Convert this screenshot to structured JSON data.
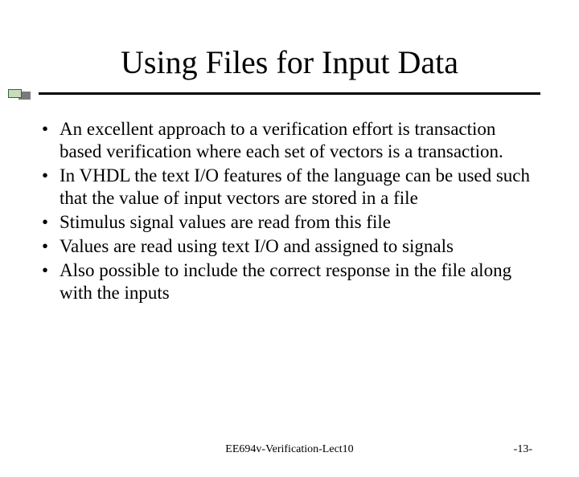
{
  "slide": {
    "title": "Using Files for Input Data",
    "bullets": [
      "An excellent approach to a verification effort is transaction based verification where each set of vectors is a transaction.",
      "In VHDL the text I/O features of the language can be used such that the value of input vectors are stored in a file",
      "Stimulus signal values are read from this file",
      "Values are read using text I/O and assigned to signals",
      "Also possible to include the correct response in the file along with the inputs"
    ],
    "footer_center": "EE694v-Verification-Lect10",
    "footer_right": "-13-"
  }
}
